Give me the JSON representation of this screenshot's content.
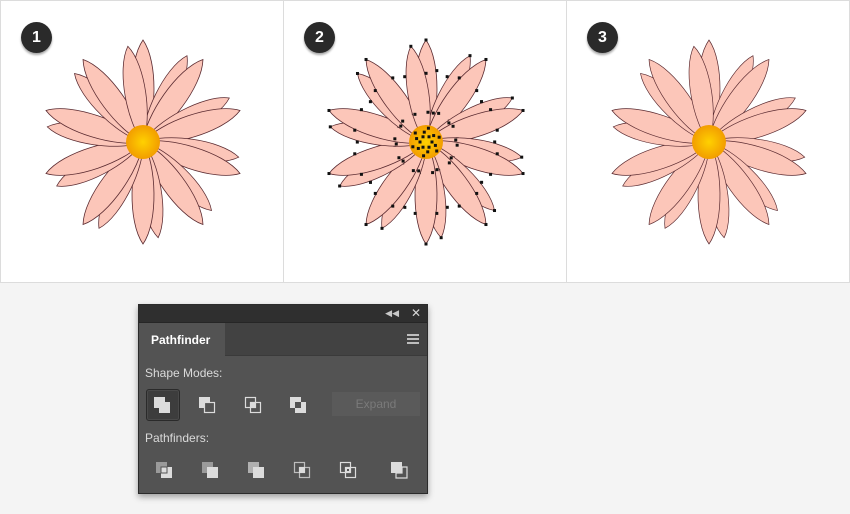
{
  "steps": [
    {
      "number": "1"
    },
    {
      "number": "2"
    },
    {
      "number": "3"
    }
  ],
  "colors": {
    "petal_dark": "#e05a86",
    "petal_light": "#fcc6b9",
    "center_outer": "#f29d00",
    "center_inner": "#ffd100",
    "panel_bg": "#535353",
    "titlebar_bg": "#2f2f2f"
  },
  "panel": {
    "tab_label": "Pathfinder",
    "shape_modes_label": "Shape Modes:",
    "pathfinders_label": "Pathfinders:",
    "expand_label": "Expand",
    "collapse_icon": "double-chevron-left-icon",
    "close_icon": "close-icon",
    "menu_icon": "panel-menu-icon",
    "shape_modes": [
      {
        "name": "unite",
        "icon": "unite-icon"
      },
      {
        "name": "minus-front",
        "icon": "minus-front-icon"
      },
      {
        "name": "intersect",
        "icon": "intersect-icon"
      },
      {
        "name": "exclude",
        "icon": "exclude-icon"
      }
    ],
    "pathfinders": [
      {
        "name": "divide",
        "icon": "divide-icon"
      },
      {
        "name": "trim",
        "icon": "trim-icon"
      },
      {
        "name": "merge",
        "icon": "merge-icon"
      },
      {
        "name": "crop",
        "icon": "crop-icon"
      },
      {
        "name": "outline",
        "icon": "outline-icon"
      },
      {
        "name": "minus-back",
        "icon": "minus-back-icon"
      }
    ]
  }
}
